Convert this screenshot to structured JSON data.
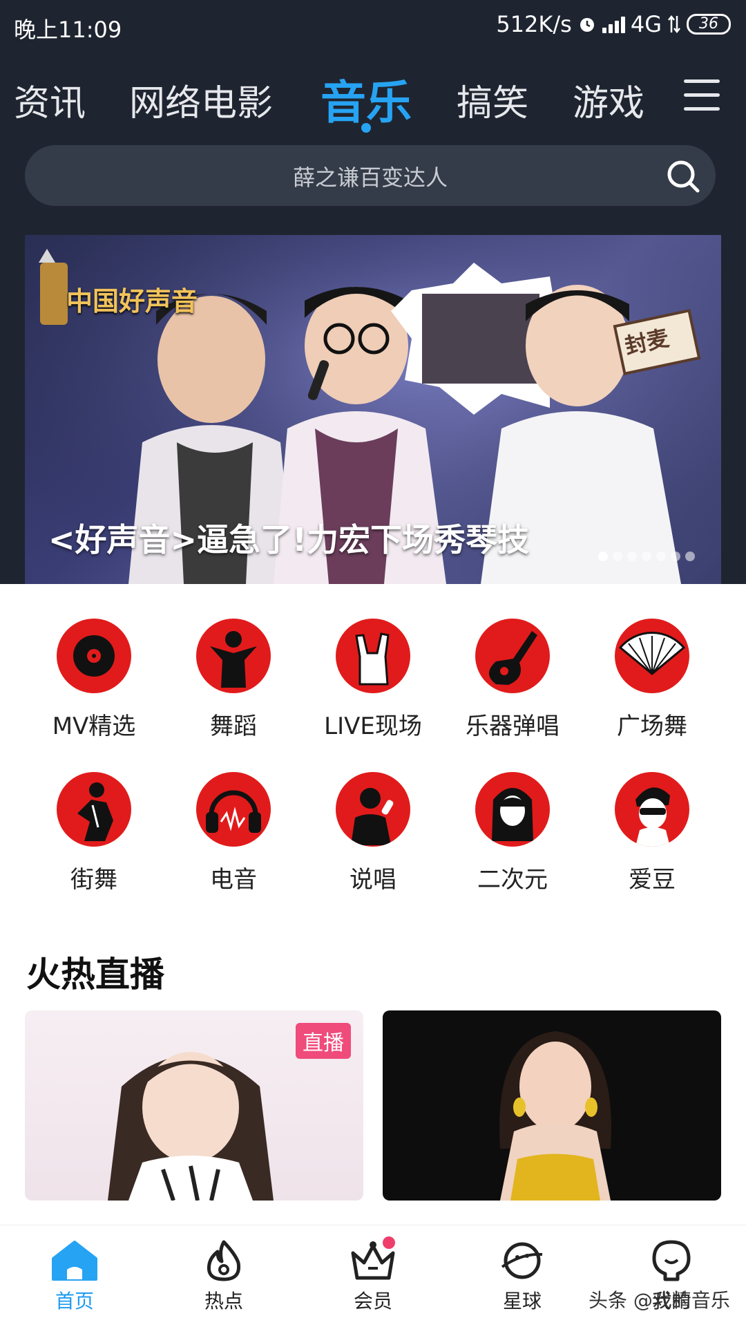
{
  "status_bar": {
    "time": "晚上11:09",
    "network_speed": "512K/s",
    "network_type": "4G",
    "battery": "36"
  },
  "tabs": [
    {
      "label": "资讯",
      "active": false
    },
    {
      "label": "网络电影",
      "active": false
    },
    {
      "label": "音乐",
      "active": true
    },
    {
      "label": "搞笑",
      "active": false
    },
    {
      "label": "游戏",
      "active": false
    }
  ],
  "search": {
    "placeholder": "薛之谦百变达人"
  },
  "banner": {
    "caption": "<好声音>逼急了!力宏下场秀琴技",
    "logo_text": "中国好声音",
    "sign_text": "封麦",
    "page_count": 7,
    "current_page": 1
  },
  "categories": [
    {
      "label": "MV精选",
      "icon": "vinyl-record-icon"
    },
    {
      "label": "舞蹈",
      "icon": "dancer-icon"
    },
    {
      "label": "LIVE现场",
      "icon": "rock-hand-icon"
    },
    {
      "label": "乐器弹唱",
      "icon": "guitar-icon"
    },
    {
      "label": "广场舞",
      "icon": "folding-fan-icon"
    },
    {
      "label": "街舞",
      "icon": "street-dancer-icon"
    },
    {
      "label": "电音",
      "icon": "headphones-icon"
    },
    {
      "label": "说唱",
      "icon": "rapper-icon"
    },
    {
      "label": "二次元",
      "icon": "anime-girl-icon"
    },
    {
      "label": "爱豆",
      "icon": "idol-icon"
    }
  ],
  "live_section": {
    "title": "火热直播",
    "badge": "直播"
  },
  "bottom_nav": [
    {
      "label": "首页",
      "icon": "home-icon",
      "active": true
    },
    {
      "label": "热点",
      "icon": "flame-icon",
      "active": false
    },
    {
      "label": "会员",
      "icon": "crown-icon",
      "active": false
    },
    {
      "label": "星球",
      "icon": "planet-icon",
      "active": false
    },
    {
      "label": "我的",
      "icon": "profile-icon",
      "active": false
    }
  ],
  "watermark": "头条 @戏精音乐",
  "colors": {
    "accent": "#27a3f3",
    "header_bg": "#1f2530",
    "category_red": "#e11b1b",
    "live_badge": "#ef4b7b"
  }
}
